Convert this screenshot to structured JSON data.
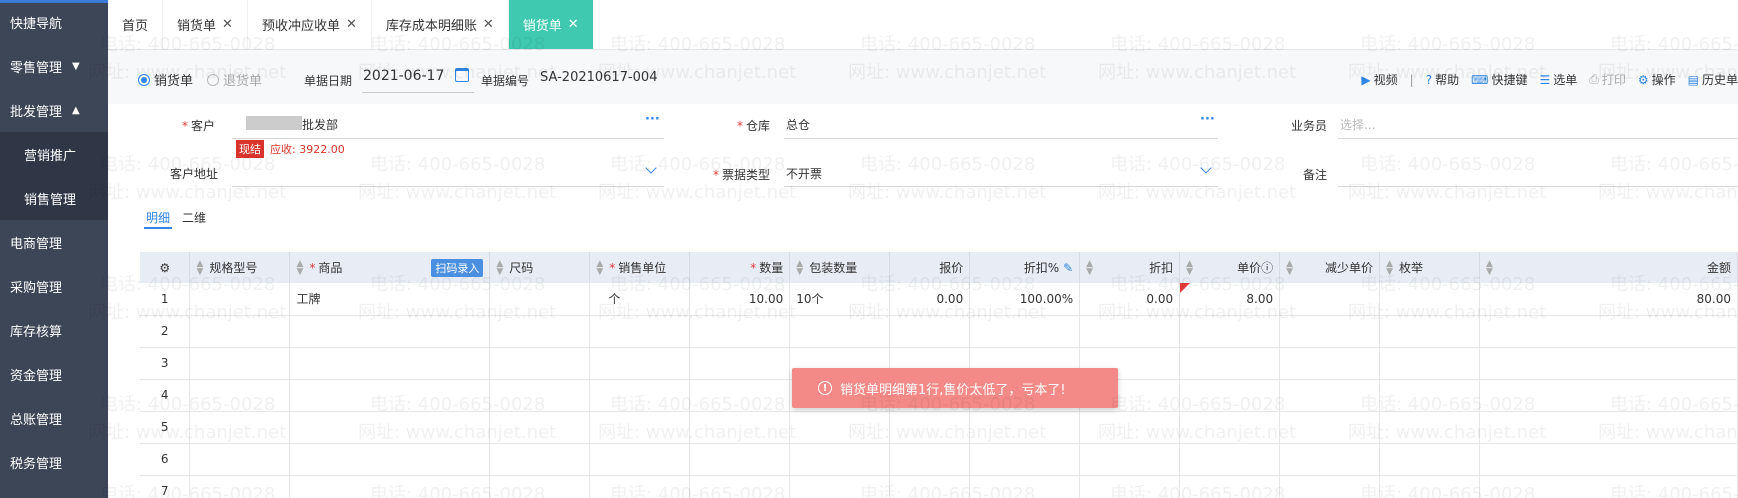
{
  "sidebar": {
    "items": [
      {
        "label": "快捷导航",
        "arrow": ""
      },
      {
        "label": "零售管理",
        "arrow": "▼"
      },
      {
        "label": "批发管理",
        "arrow": "▲"
      },
      {
        "label": "营销推广",
        "arrow": ""
      },
      {
        "label": "销售管理",
        "arrow": ""
      },
      {
        "label": "电商管理",
        "arrow": ""
      },
      {
        "label": "采购管理",
        "arrow": ""
      },
      {
        "label": "库存核算",
        "arrow": ""
      },
      {
        "label": "资金管理",
        "arrow": ""
      },
      {
        "label": "总账管理",
        "arrow": ""
      },
      {
        "label": "税务管理",
        "arrow": ""
      }
    ]
  },
  "tabs": [
    {
      "label": "首页",
      "close": ""
    },
    {
      "label": "销货单",
      "close": "✕"
    },
    {
      "label": "预收冲应收单",
      "close": "✕"
    },
    {
      "label": "库存成本明细账",
      "close": "✕"
    },
    {
      "label": "销货单",
      "close": "✕"
    }
  ],
  "header": {
    "radio_sale": "销货单",
    "radio_return": "退货单",
    "date_label": "单据日期",
    "date_value": "2021-06-17",
    "no_label": "单据编号",
    "no_value": "SA-20210617-004"
  },
  "toolbar": [
    {
      "icon": "▶",
      "label": "视频"
    },
    {
      "icon": "?",
      "label": "帮助"
    },
    {
      "icon": "⌨",
      "label": "快捷键"
    },
    {
      "icon": "☰",
      "label": "选单"
    },
    {
      "icon": "⎙",
      "label": "打印"
    },
    {
      "icon": "⚙",
      "label": "操作"
    },
    {
      "icon": "▤",
      "label": "历史单"
    }
  ],
  "form": {
    "customer_label": "客户",
    "customer_value": "批发部",
    "customer_badge": "现结",
    "customer_receivable": "应收: 3922.00",
    "address_label": "客户地址",
    "warehouse_label": "仓库",
    "warehouse_value": "总仓",
    "invoice_label": "票据类型",
    "invoice_value": "不开票",
    "salesman_label": "业务员",
    "salesman_placeholder": "选择...",
    "remark_label": "备注",
    "ellipsis": "···"
  },
  "subtabs": {
    "detail": "明细",
    "qr": "二维"
  },
  "table": {
    "headers": {
      "spec": "规格型号",
      "product": "商品",
      "scan": "扫码录入",
      "barcode": "尺码",
      "unit": "销售单位",
      "qty": "数量",
      "pack_qty": "包装数量",
      "quote": "报价",
      "discount_pct": "折扣%",
      "discount": "折扣",
      "price": "单价",
      "reduce": "减少单价",
      "enum": "枚举",
      "amount": "金额"
    },
    "rows": [
      {
        "no": "1",
        "product": "工牌",
        "unit": "个",
        "qty": "10.00",
        "pack": "10个",
        "quote": "0.00",
        "pct": "100.00%",
        "disc": "0.00",
        "price": "8.00",
        "amount": "80.00"
      },
      {
        "no": "2",
        "product": "",
        "unit": "",
        "qty": "",
        "pack": "",
        "quote": "",
        "pct": "",
        "disc": "",
        "price": "",
        "amount": ""
      },
      {
        "no": "3",
        "product": "",
        "unit": "",
        "qty": "",
        "pack": "",
        "quote": "",
        "pct": "",
        "disc": "",
        "price": "",
        "amount": ""
      },
      {
        "no": "4",
        "product": "",
        "unit": "",
        "qty": "",
        "pack": "",
        "quote": "",
        "pct": "",
        "disc": "",
        "price": "",
        "amount": ""
      },
      {
        "no": "5",
        "product": "",
        "unit": "",
        "qty": "",
        "pack": "",
        "quote": "",
        "pct": "",
        "disc": "",
        "price": "",
        "amount": ""
      },
      {
        "no": "6",
        "product": "",
        "unit": "",
        "qty": "",
        "pack": "",
        "quote": "",
        "pct": "",
        "disc": "",
        "price": "",
        "amount": ""
      },
      {
        "no": "7",
        "product": "",
        "unit": "",
        "qty": "",
        "pack": "",
        "quote": "",
        "pct": "",
        "disc": "",
        "price": "",
        "amount": ""
      }
    ]
  },
  "toast": {
    "message": "销货单明细第1行,售价太低了，亏本了!"
  },
  "watermark": {
    "phone": "电话: 400-665-0028",
    "site": "网址: www.chanjet.net"
  },
  "colors": {
    "sidebar": "#3d4657",
    "active_tab": "#3ec9b0",
    "accent": "#2f86e5",
    "toast": "#f48a87",
    "error": "#d9342b"
  }
}
